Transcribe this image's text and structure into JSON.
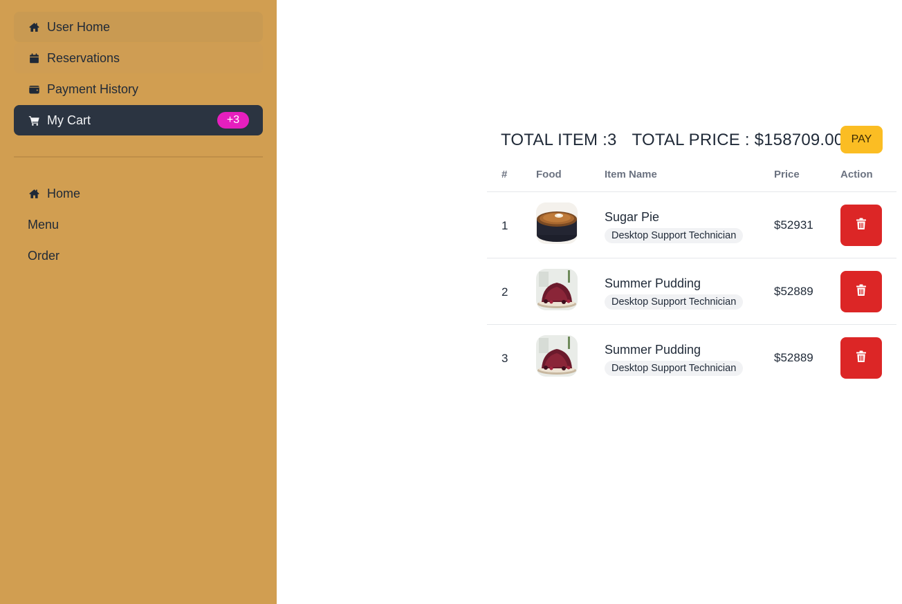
{
  "sidebar": {
    "top_items": [
      {
        "label": "User Home",
        "icon": "home-icon"
      },
      {
        "label": "Reservations",
        "icon": "calendar-icon"
      },
      {
        "label": "Payment History",
        "icon": "wallet-icon"
      },
      {
        "label": "My Cart",
        "icon": "cart-icon",
        "badge": "+3"
      }
    ],
    "bottom_items": [
      {
        "label": "Home",
        "icon": "home-icon"
      },
      {
        "label": "Menu"
      },
      {
        "label": "Order"
      }
    ]
  },
  "summary": {
    "total_items": "TOTAL ITEM :3",
    "total_price": "TOTAL PRICE : $158709.00",
    "pay_label": "PAY"
  },
  "table": {
    "headers": [
      "#",
      "Food",
      "Item Name",
      "Price",
      "Action"
    ],
    "rows": [
      {
        "num": "1",
        "name": "Sugar Pie",
        "category": "Desktop Support Technician",
        "price": "$52931",
        "image": "sugar-pie"
      },
      {
        "num": "2",
        "name": "Summer Pudding",
        "category": "Desktop Support Technician",
        "price": "$52889",
        "image": "summer-pudding"
      },
      {
        "num": "3",
        "name": "Summer Pudding",
        "category": "Desktop Support Technician",
        "price": "$52889",
        "image": "summer-pudding"
      }
    ]
  },
  "colors": {
    "sidebar_bg": "#d19e51",
    "active_bg": "#2b3441",
    "badge_bg": "#e61fbe",
    "pay_bg": "#fbbd23",
    "delete_bg": "#dc2626"
  }
}
